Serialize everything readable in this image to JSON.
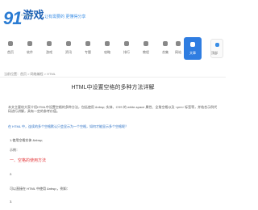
{
  "site": {
    "logo_number": "91",
    "logo_text": "游戏",
    "logo_sub": "91.game",
    "slogan": "让有需要的 更懂得分享"
  },
  "nav": {
    "items": [
      {
        "label": "首页",
        "icon": "home-icon"
      },
      {
        "label": "软件",
        "icon": "apps-icon"
      },
      {
        "label": "游戏",
        "icon": "gamepad-icon"
      },
      {
        "label": "资讯",
        "icon": "news-icon"
      },
      {
        "label": "专题",
        "icon": "topic-icon"
      },
      {
        "label": "攻略",
        "icon": "guide-icon"
      },
      {
        "label": "排行",
        "icon": "rank-icon"
      },
      {
        "label": "教程",
        "icon": "tutorial-icon"
      },
      {
        "label": "合集",
        "icon": "collection-icon"
      },
      {
        "label": "网站",
        "icon": "web-icon"
      },
      {
        "label": "文章",
        "icon": "article-icon",
        "active": true
      }
    ],
    "scroll_top_label": "顶部"
  },
  "breadcrumb": "当前位置：首页 > 网络编程 > HTML",
  "article": {
    "title": "HTML中设置空格的多种方法详解",
    "paragraph1": "本文主要给大家介绍HTML中设置空格的多种方法，包括使用 &nbsp; 实体、CSS 的 white-space 属性、全角空格以及 <pre> 标签等，并结合示例代码进行讲解，具有一定的参考价值。",
    "paragraph2": "在 HTML 中，连续的多个空格默认只会显示为一个空格，如何才能显示多个空格呢？",
    "code_line": "1.使用空格实体 &nbsp;",
    "sub_line": "示例：",
    "red_line": "一、空格的使用方法",
    "note_line": "2.",
    "bottom_line": "可以直接在 HTML 中使用 &nbsp;，例如：",
    "last_line": "3."
  },
  "colors": {
    "brand_blue": "#2b7cd3",
    "active_nav": "#2f7de1",
    "red_heading": "#e4393c"
  }
}
